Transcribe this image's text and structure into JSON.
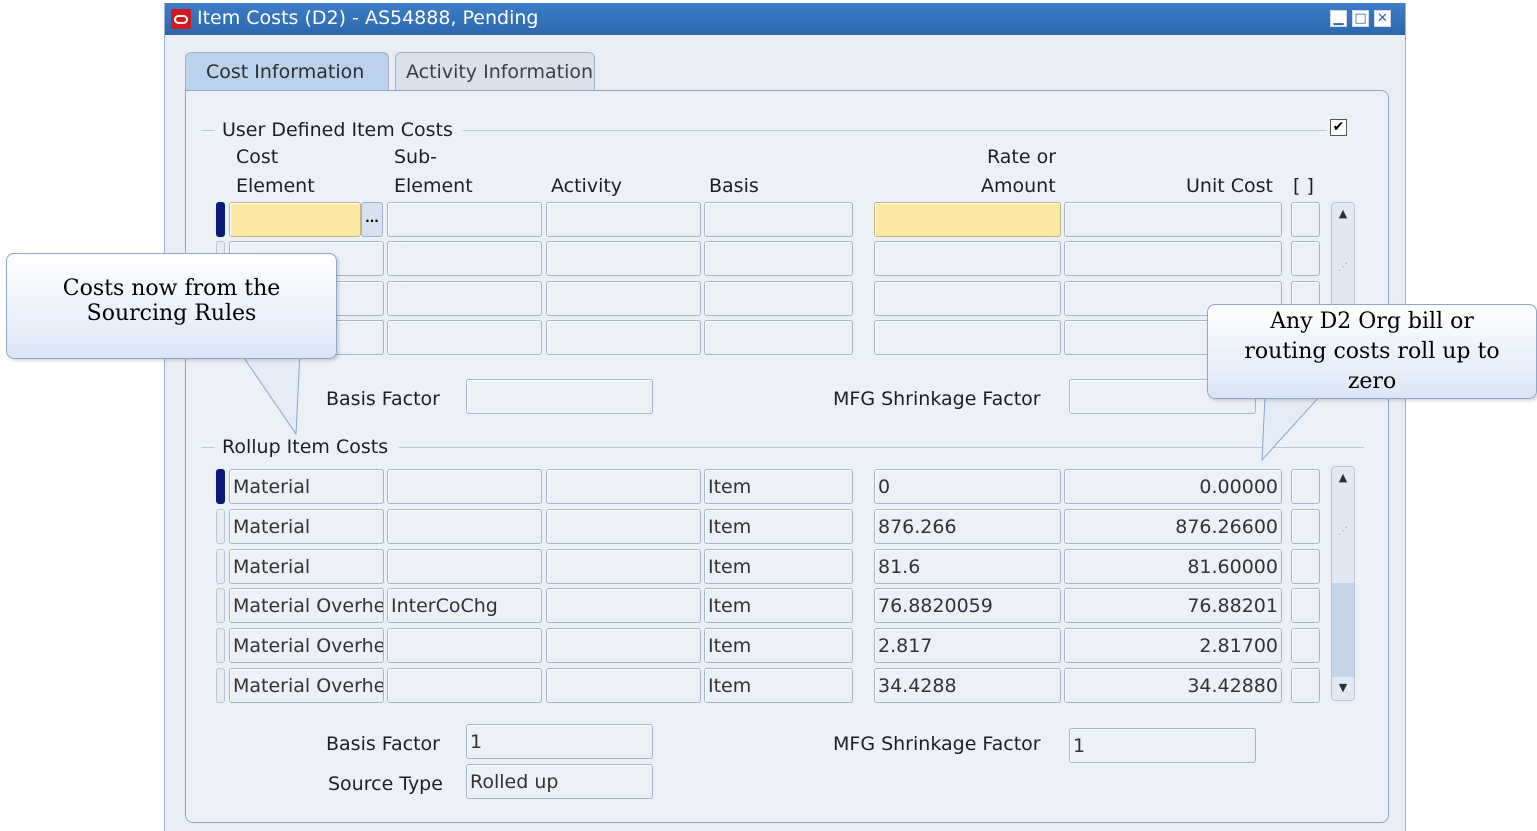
{
  "window": {
    "title": "Item Costs (D2) - AS54888, Pending"
  },
  "tabs": [
    {
      "label": "Cost Information",
      "active": true
    },
    {
      "label": "Activity Information",
      "active": false
    }
  ],
  "user_defined": {
    "title": "User Defined Item Costs",
    "checkbox_checked": true,
    "headers": {
      "cost_element_1": "Cost",
      "cost_element_2": "Element",
      "sub_element_1": "Sub-",
      "sub_element_2": "Element",
      "activity": "Activity",
      "basis": "Basis",
      "rate_1": "Rate or",
      "rate_2": "Amount",
      "unit_cost": "Unit Cost",
      "flex": "[ ]"
    },
    "basis_factor_label": "Basis Factor",
    "basis_factor_value": "",
    "mfg_shrinkage_label": "MFG Shrinkage Factor",
    "mfg_shrinkage_value": ""
  },
  "rollup": {
    "title": "Rollup Item Costs",
    "rows": [
      {
        "cost_element": "Material",
        "sub_element": "",
        "activity": "",
        "basis": "Item",
        "rate": "0",
        "unit_cost": "0.00000"
      },
      {
        "cost_element": "Material",
        "sub_element": "",
        "activity": "",
        "basis": "Item",
        "rate": "876.266",
        "unit_cost": "876.26600"
      },
      {
        "cost_element": "Material",
        "sub_element": "",
        "activity": "",
        "basis": "Item",
        "rate": "81.6",
        "unit_cost": "81.60000"
      },
      {
        "cost_element": "Material Overhe",
        "sub_element": "InterCoChg",
        "activity": "",
        "basis": "Item",
        "rate": "76.8820059",
        "unit_cost": "76.88201"
      },
      {
        "cost_element": "Material Overhe",
        "sub_element": "",
        "activity": "",
        "basis": "Item",
        "rate": "2.817",
        "unit_cost": "2.81700"
      },
      {
        "cost_element": "Material Overhe",
        "sub_element": "",
        "activity": "",
        "basis": "Item",
        "rate": "34.4288",
        "unit_cost": "34.42880"
      }
    ],
    "basis_factor_label": "Basis Factor",
    "basis_factor_value": "1",
    "mfg_shrinkage_label": "MFG Shrinkage Factor",
    "mfg_shrinkage_value": "1",
    "source_type_label": "Source Type",
    "source_type_value": "Rolled up"
  },
  "callouts": {
    "left": "Costs now from the Sourcing Rules",
    "right": "Any D2 Org bill or routing costs roll up to zero"
  },
  "colors": {
    "title_bar": "#2c67ad",
    "required_field": "#fde9a6",
    "panel": "#ecf0f7"
  }
}
